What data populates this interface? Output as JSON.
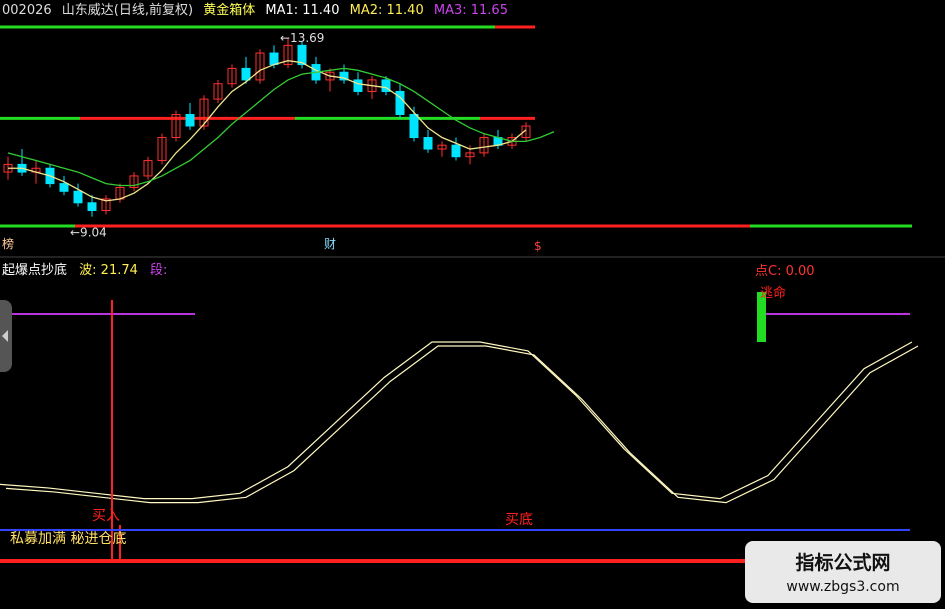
{
  "header": {
    "code": "002026",
    "name": "山东威达(日线,前复权)",
    "indicator": "黄金箱体",
    "ma1_label": "MA1: 11.40",
    "ma2_label": "MA2: 11.40",
    "ma3_label": "MA3: 11.65"
  },
  "lower_header": {
    "name": "起爆点抄底",
    "wave": "波: 21.74",
    "segment": "段:",
    "right_value": "点C: 0.00"
  },
  "annotations": {
    "high": "13.69",
    "low": "9.04",
    "ticker_left": "榜",
    "ticker_mid": "财",
    "ticker_right": "$",
    "buy": "买入",
    "bottom1": "私募加满 秘进仓底",
    "bottom2": "买底",
    "top": "逃命"
  },
  "watermark": {
    "title": "指标公式网",
    "url": "www.zbgs3.com"
  },
  "colors": {
    "up": "#ff3030",
    "down": "#00e5ff",
    "green": "#22dd22",
    "red": "#ff2020",
    "ma_fast": "#f0e68c",
    "ma_slow": "#33cc33",
    "osc": "#fff8c0",
    "purple": "#bb33dd",
    "blue": "#3344ff"
  },
  "chart_data": {
    "type": "candlestick",
    "candles": [
      [
        10.2,
        10.6,
        10.0,
        10.4
      ],
      [
        10.4,
        10.8,
        10.1,
        10.2
      ],
      [
        10.2,
        10.5,
        9.9,
        10.3
      ],
      [
        10.3,
        10.4,
        9.8,
        9.9
      ],
      [
        9.9,
        10.1,
        9.6,
        9.7
      ],
      [
        9.7,
        9.9,
        9.3,
        9.4
      ],
      [
        9.4,
        9.6,
        9.04,
        9.2
      ],
      [
        9.2,
        9.6,
        9.1,
        9.5
      ],
      [
        9.5,
        9.9,
        9.4,
        9.8
      ],
      [
        9.8,
        10.2,
        9.7,
        10.1
      ],
      [
        10.1,
        10.6,
        10.0,
        10.5
      ],
      [
        10.5,
        11.2,
        10.4,
        11.1
      ],
      [
        11.1,
        11.8,
        11.0,
        11.7
      ],
      [
        11.7,
        12.0,
        11.3,
        11.4
      ],
      [
        11.4,
        12.2,
        11.3,
        12.1
      ],
      [
        12.1,
        12.6,
        12.0,
        12.5
      ],
      [
        12.5,
        13.0,
        12.4,
        12.9
      ],
      [
        12.9,
        13.2,
        12.5,
        12.6
      ],
      [
        12.6,
        13.4,
        12.5,
        13.3
      ],
      [
        13.3,
        13.5,
        12.9,
        13.0
      ],
      [
        13.0,
        13.69,
        12.9,
        13.5
      ],
      [
        13.5,
        13.6,
        12.9,
        13.0
      ],
      [
        13.0,
        13.2,
        12.5,
        12.6
      ],
      [
        12.6,
        12.9,
        12.3,
        12.8
      ],
      [
        12.8,
        13.0,
        12.5,
        12.6
      ],
      [
        12.6,
        12.8,
        12.2,
        12.3
      ],
      [
        12.3,
        12.7,
        12.1,
        12.6
      ],
      [
        12.6,
        12.7,
        12.2,
        12.3
      ],
      [
        12.3,
        12.5,
        11.6,
        11.7
      ],
      [
        11.7,
        11.9,
        11.0,
        11.1
      ],
      [
        11.1,
        11.3,
        10.7,
        10.8
      ],
      [
        10.8,
        11.0,
        10.6,
        10.9
      ],
      [
        10.9,
        11.1,
        10.5,
        10.6
      ],
      [
        10.6,
        10.9,
        10.4,
        10.7
      ],
      [
        10.7,
        11.2,
        10.6,
        11.1
      ],
      [
        11.1,
        11.3,
        10.8,
        10.9
      ],
      [
        10.9,
        11.2,
        10.8,
        11.1
      ],
      [
        11.1,
        11.5,
        11.0,
        11.4
      ]
    ],
    "ma1": [
      10.3,
      10.3,
      10.2,
      10.1,
      9.95,
      9.75,
      9.55,
      9.45,
      9.5,
      9.65,
      9.9,
      10.25,
      10.7,
      11.05,
      11.45,
      11.9,
      12.3,
      12.55,
      12.85,
      13.0,
      13.1,
      13.05,
      12.85,
      12.7,
      12.65,
      12.5,
      12.45,
      12.4,
      12.15,
      11.75,
      11.35,
      11.1,
      10.95,
      10.8,
      10.85,
      10.9,
      11.0,
      11.3
    ],
    "ma2": [
      10.7,
      10.6,
      10.5,
      10.4,
      10.3,
      10.2,
      10.05,
      9.9,
      9.85,
      9.85,
      9.95,
      10.1,
      10.3,
      10.5,
      10.8,
      11.1,
      11.45,
      11.75,
      12.05,
      12.35,
      12.6,
      12.75,
      12.8,
      12.85,
      12.9,
      12.85,
      12.75,
      12.65,
      12.5,
      12.3,
      12.05,
      11.8,
      11.55,
      11.35,
      11.2,
      11.1,
      11.0,
      11.0,
      11.1,
      11.25
    ],
    "box_lines": [
      11.6,
      9.3
    ],
    "oscillator": [
      20,
      18,
      15,
      12,
      12,
      15,
      30,
      55,
      80,
      100,
      100,
      95,
      70,
      40,
      15,
      12,
      25,
      55,
      85,
      100
    ]
  }
}
